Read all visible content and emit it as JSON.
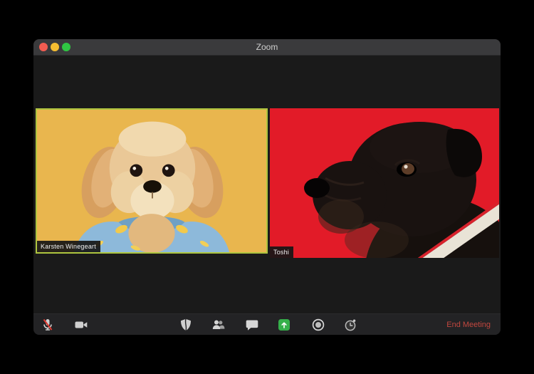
{
  "window": {
    "title": "Zoom"
  },
  "traffic_lights": {
    "close_color": "#f25c51",
    "minimize_color": "#f5bd31",
    "fullscreen_color": "#2fc643"
  },
  "participants": [
    {
      "name": "Karsten Winegeart",
      "video_bg_color": "#e9b64e",
      "active_speaker": true,
      "video_desc": "fluffy tan puppy wearing a blue shirt on a yellow background"
    },
    {
      "name": "Toshi",
      "video_bg_color": "#e21b28",
      "active_speaker": false,
      "video_desc": "black pug in profile wearing a red, white and navy striped sweater on a red background"
    }
  ],
  "toolbar": {
    "icons": [
      {
        "name": "microphone-muted-icon"
      },
      {
        "name": "video-camera-icon"
      },
      {
        "name": "security-shield-icon"
      },
      {
        "name": "participants-icon"
      },
      {
        "name": "chat-icon"
      },
      {
        "name": "share-screen-icon",
        "accent": "#35b04a"
      },
      {
        "name": "record-icon"
      },
      {
        "name": "reactions-timer-icon"
      }
    ],
    "end_meeting_label": "End Meeting",
    "end_meeting_color": "#c1473f"
  },
  "colors": {
    "desktop_bg": "#000000",
    "window_bg": "#1a1a1a",
    "titlebar_bg": "#3a3a3c",
    "toolbar_bg": "#232325",
    "active_speaker_border": "#aec53f",
    "name_label_bg": "#161616"
  }
}
